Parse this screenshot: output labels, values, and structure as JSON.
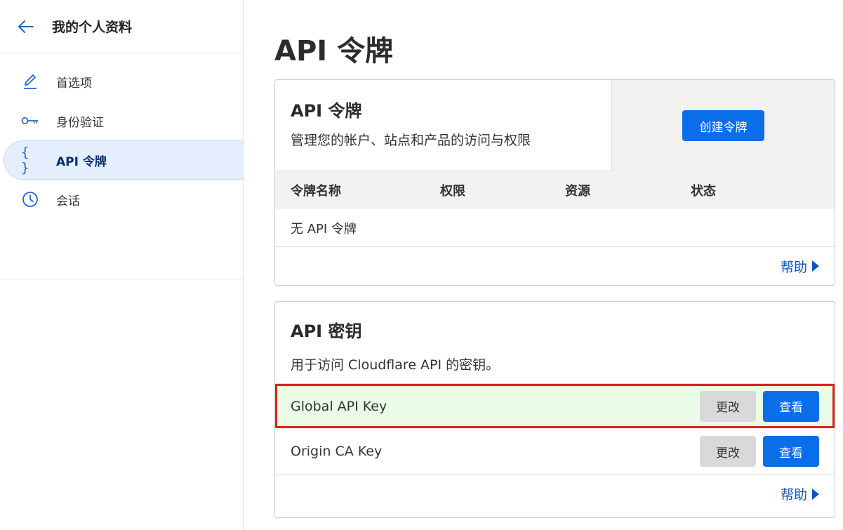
{
  "sidebar": {
    "title": "我的个人资料",
    "items": [
      {
        "label": "首选项",
        "icon": "pencil-icon"
      },
      {
        "label": "身份验证",
        "icon": "key-icon"
      },
      {
        "label": "API 令牌",
        "icon": "braces-icon",
        "glyph": "{ }"
      },
      {
        "label": "会话",
        "icon": "clock-icon"
      }
    ]
  },
  "main": {
    "title": "API 令牌",
    "tokens_card": {
      "title": "API 令牌",
      "description": "管理您的帐户、站点和产品的访问与权限",
      "create_button": "创建令牌",
      "columns": [
        "令牌名称",
        "权限",
        "资源",
        "状态"
      ],
      "empty_text": "无 API 令牌",
      "help_link": "帮助"
    },
    "keys_card": {
      "title": "API 密钥",
      "description": "用于访问 Cloudflare API 的密钥。",
      "rows": [
        {
          "name": "Global API Key",
          "change_label": "更改",
          "view_label": "查看"
        },
        {
          "name": "Origin CA Key",
          "change_label": "更改",
          "view_label": "查看"
        }
      ],
      "help_link": "帮助"
    }
  },
  "colors": {
    "primary": "#0a6dea",
    "link": "#0a56c2",
    "highlight_bg": "#eafbe8",
    "highlight_border": "#d9261c",
    "active_nav_bg": "#e4eefc"
  }
}
